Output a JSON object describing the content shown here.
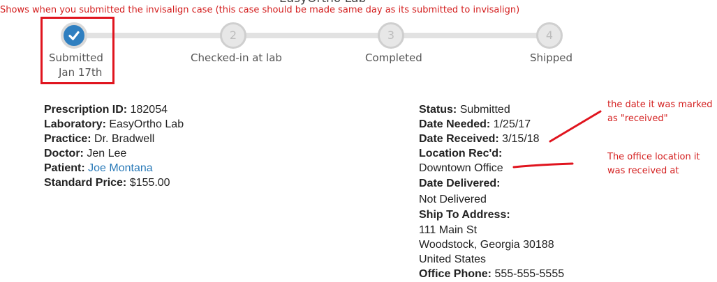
{
  "page_title": "EasyOrtho Lab",
  "annotations": {
    "top_note": "Shows when you submitted the invisalign case (this case should be made same day as its submitted to invisalign)",
    "received_note_line1": "the date it was marked",
    "received_note_line2": "as \"received\"",
    "location_note_line1": "The office location it",
    "location_note_line2": "was received at"
  },
  "progress": {
    "steps": [
      {
        "number": "",
        "label": "Submitted",
        "sub": "Jan 17th",
        "state": "done"
      },
      {
        "number": "2",
        "label": "Checked-in at lab",
        "sub": "",
        "state": "pending"
      },
      {
        "number": "3",
        "label": "Completed",
        "sub": "",
        "state": "pending"
      },
      {
        "number": "4",
        "label": "Shipped",
        "sub": "",
        "state": "pending"
      }
    ]
  },
  "left_details": {
    "prescription_id": {
      "label": "Prescription ID:",
      "value": "182054"
    },
    "laboratory": {
      "label": "Laboratory:",
      "value": "EasyOrtho Lab"
    },
    "practice": {
      "label": "Practice:",
      "value": "Dr. Bradwell"
    },
    "doctor": {
      "label": "Doctor:",
      "value": "Jen Lee"
    },
    "patient": {
      "label": "Patient:",
      "value": "Joe Montana"
    },
    "standard_price": {
      "label": "Standard Price:",
      "value": "$155.00"
    }
  },
  "right_details": {
    "status": {
      "label": "Status:",
      "value": "Submitted"
    },
    "date_needed": {
      "label": "Date Needed:",
      "value": "1/25/17"
    },
    "date_received": {
      "label": "Date Received:",
      "value": "3/15/18"
    },
    "location_recd": {
      "label": "Location Rec'd:",
      "value": "Downtown Office"
    },
    "date_delivered": {
      "label": "Date Delivered:",
      "value": "Not Delivered"
    },
    "ship_to": {
      "label": "Ship To Address:",
      "line1": "111 Main St",
      "line2": "Woodstock, Georgia 30188",
      "line3": "United States"
    },
    "office_phone": {
      "label": "Office Phone:",
      "value": "555-555-5555"
    }
  },
  "colors": {
    "annotation_red": "#d42020",
    "step_done_blue": "#2f7fc0",
    "link_blue": "#2a7ab8"
  }
}
